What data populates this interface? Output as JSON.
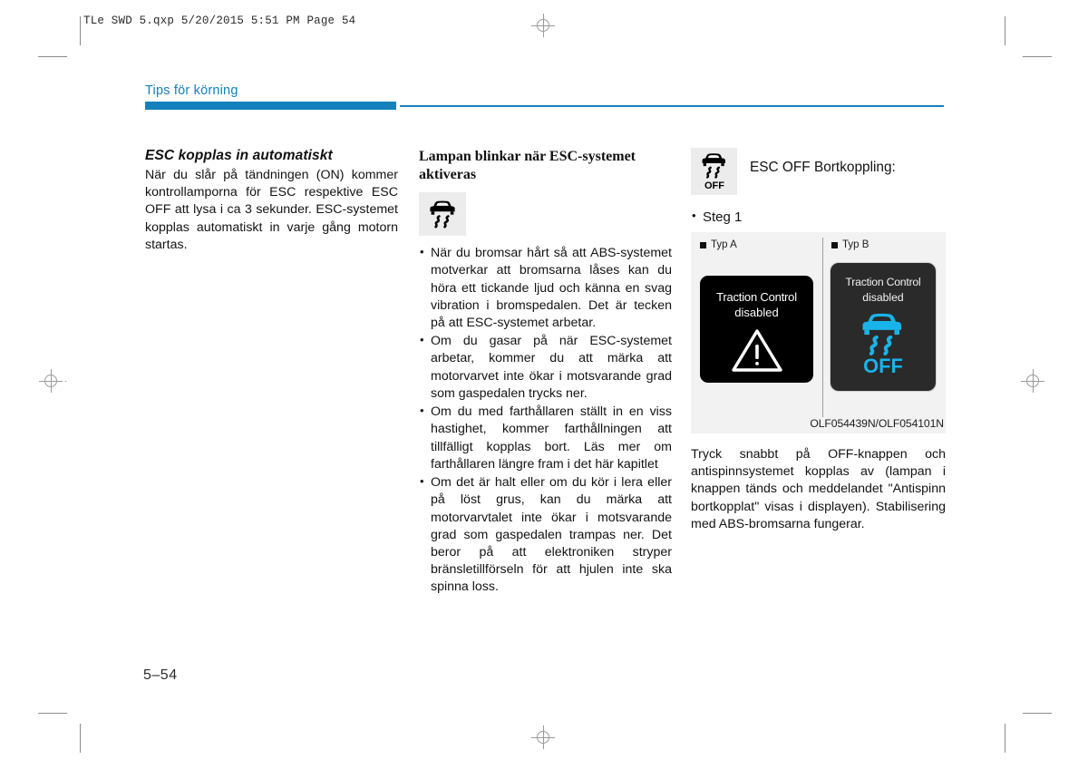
{
  "print_marks": {
    "file_header": "TLe SWD 5.qxp   5/20/2015   5:51 PM   Page 54"
  },
  "running_head": {
    "title": "Tips för körning",
    "accent_color": "#1481bc"
  },
  "columns": {
    "left": {
      "heading": "ESC kopplas in automatiskt",
      "body": "När du slår på tändningen (ON) kommer kontrollamporna för ESC respektive ESC OFF att lysa i ca 3 sekunder. ESC-systemet kopplas automatiskt in varje gång motorn startas."
    },
    "middle": {
      "heading": "Lampan blinkar när ESC-systemet aktiveras",
      "icon": "esc-skid-icon",
      "bullets": [
        "När du bromsar hårt så att ABS-systemet motverkar att bromsarna låses kan du höra ett tickande ljud och känna en svag vibration i bromspedalen. Det är tecken på att ESC-systemet arbetar.",
        "Om du gasar på när ESC-systemet arbetar, kommer du att märka att motorvarvet inte ökar i motsvarande grad som gaspedalen trycks ner.",
        "Om du med farthållaren ställt in en viss hastighet, kommer farthållningen att tillfälligt kopplas bort. Läs mer om farthållaren längre fram i det här kapitlet",
        "Om det är halt eller om du kör i lera eller på löst grus, kan du märka att motorvarvtalet inte ökar i motsvarande grad som gaspedalen trampas ner. Det beror på att elektroniken stryper bränsletillförseln för att hjulen inte ska spinna loss."
      ]
    },
    "right": {
      "icon": "esc-off-icon",
      "icon_label": "OFF",
      "title": "ESC OFF Bortkoppling:",
      "step": "Steg 1",
      "figure": {
        "type_a_label": "Typ A",
        "type_b_label": "Typ B",
        "screen_a": {
          "line1": "Traction Control",
          "line2": "disabled",
          "icon": "warning-triangle-icon"
        },
        "screen_b": {
          "line1": "Traction Control",
          "line2": "disabled",
          "icon": "esc-off-icon-cyan",
          "icon_label": "OFF",
          "icon_color": "#18b4e9"
        },
        "caption": "OLF054439N/OLF054101N"
      },
      "body": "Tryck snabbt på OFF-knappen och antispinnsystemet kopplas av (lampan i knappen tänds och meddelandet \"Antispinn bortkopplat\" visas i displayen). Stabilisering med ABS-bromsarna fungerar."
    }
  },
  "folio": "5–54"
}
